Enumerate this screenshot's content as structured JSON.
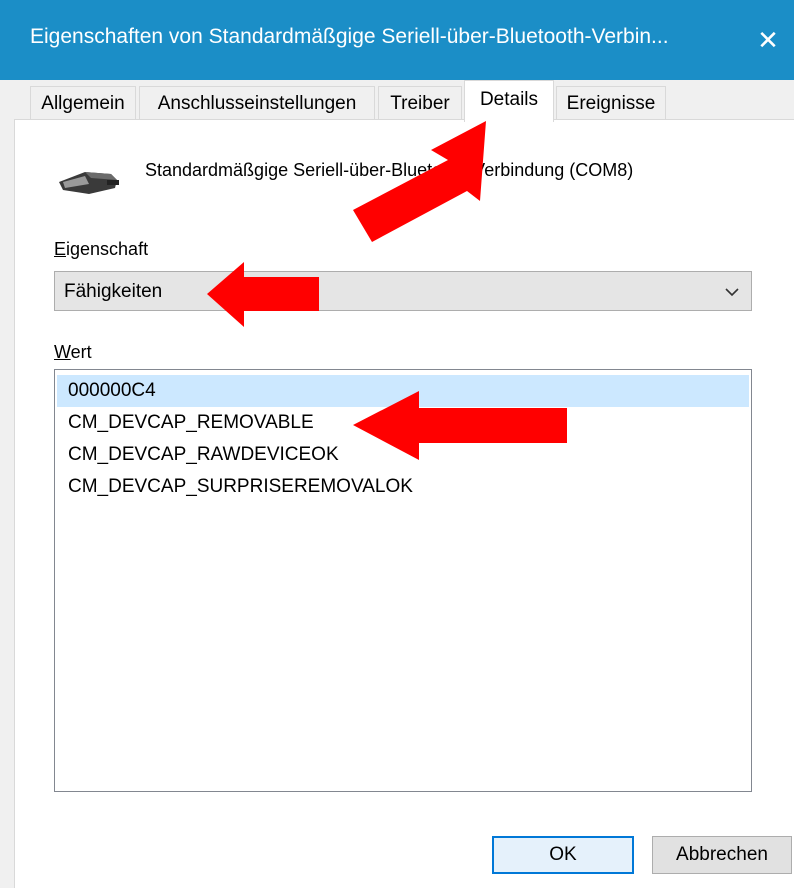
{
  "window": {
    "title": "Eigenschaften von Standardmäßgige Seriell-über-Bluetooth-Verbin...",
    "close_icon": "close-icon"
  },
  "tabs": [
    {
      "label": "Allgemein",
      "active": false
    },
    {
      "label": "Anschlusseinstellungen",
      "active": false
    },
    {
      "label": "Treiber",
      "active": false
    },
    {
      "label": "Details",
      "active": true
    },
    {
      "label": "Ereignisse",
      "active": false
    }
  ],
  "device": {
    "icon": "serial-connector-icon",
    "name": "Standardmäßgige Seriell-über-Bluetooth-Verbindung (COM8)"
  },
  "property": {
    "label_accel": "E",
    "label_rest": "igenschaft",
    "selected": "Fähigkeiten",
    "dropdown_icon": "chevron-down-icon"
  },
  "value": {
    "label_accel": "W",
    "label_rest": "ert",
    "items": [
      {
        "text": "000000C4",
        "selected": true
      },
      {
        "text": "CM_DEVCAP_REMOVABLE",
        "selected": false
      },
      {
        "text": "CM_DEVCAP_RAWDEVICEOK",
        "selected": false
      },
      {
        "text": "CM_DEVCAP_SURPRISEREMOVALOK",
        "selected": false
      }
    ]
  },
  "buttons": {
    "ok": "OK",
    "cancel": "Abbrechen"
  },
  "annotation_color": "#ff0000"
}
